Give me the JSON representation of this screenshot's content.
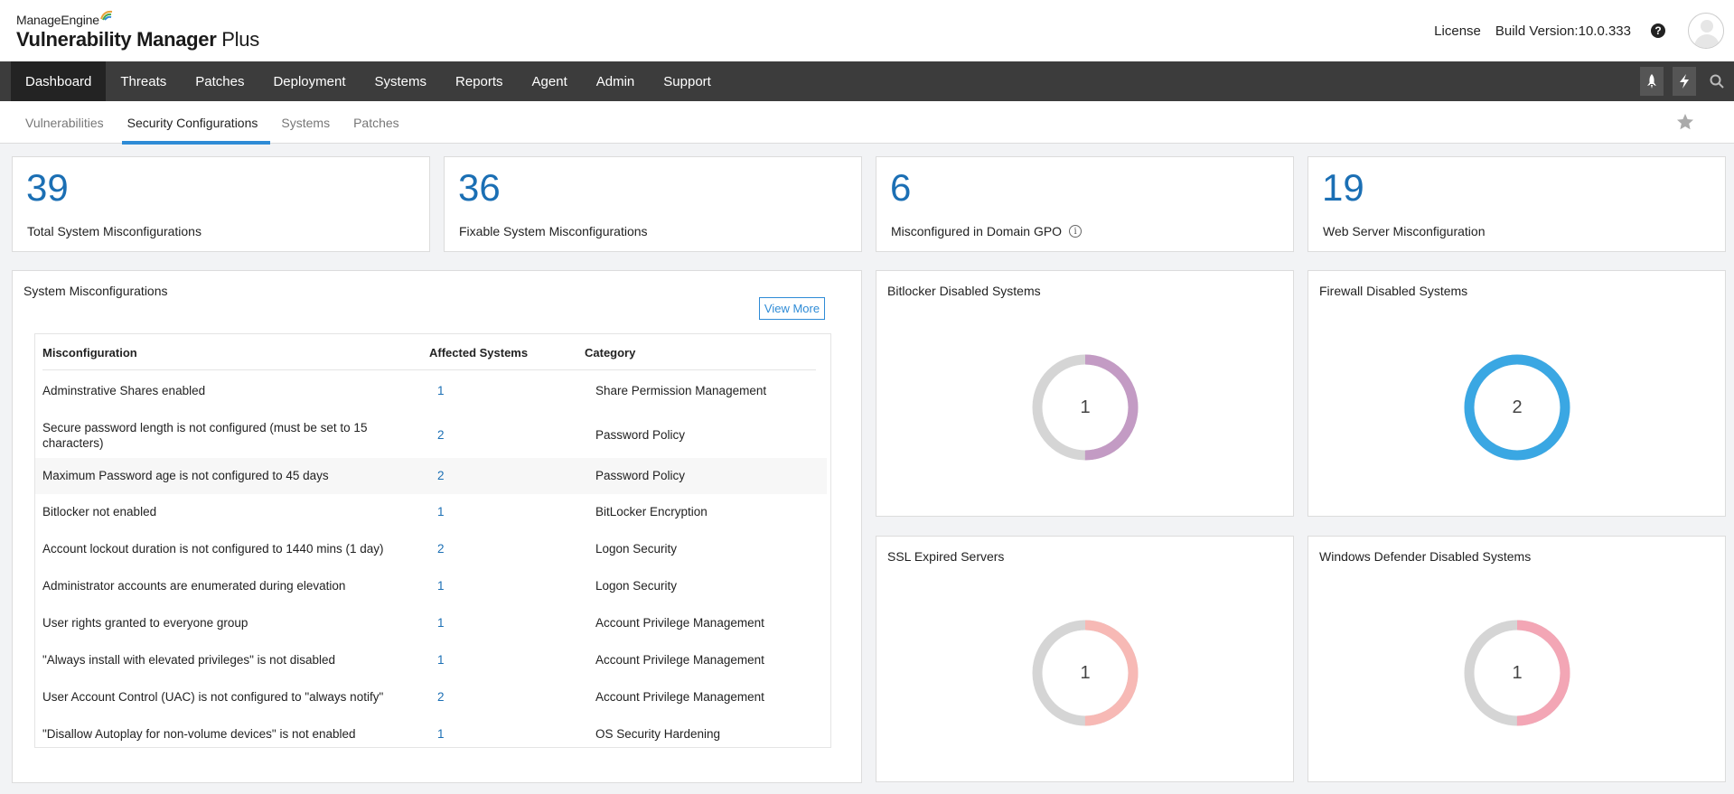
{
  "header": {
    "brand_company": "ManageEngine",
    "brand_product_bold": "Vulnerability Manager",
    "brand_product_plus": " Plus",
    "license_link": "License",
    "build_version": "Build Version:10.0.333",
    "help_icon": "?"
  },
  "main_nav": {
    "items": [
      {
        "label": "Dashboard",
        "active": true
      },
      {
        "label": "Threats"
      },
      {
        "label": "Patches"
      },
      {
        "label": "Deployment"
      },
      {
        "label": "Systems"
      },
      {
        "label": "Reports"
      },
      {
        "label": "Agent"
      },
      {
        "label": "Admin"
      },
      {
        "label": "Support"
      }
    ],
    "tools": [
      "rocket-icon",
      "lightning-icon",
      "search-icon"
    ]
  },
  "sub_nav": {
    "items": [
      {
        "label": "Vulnerabilities"
      },
      {
        "label": "Security Configurations",
        "active": true
      },
      {
        "label": "Systems"
      },
      {
        "label": "Patches"
      }
    ],
    "favorite_icon": "star-icon"
  },
  "stats": [
    {
      "value": "39",
      "label": "Total System Misconfigurations"
    },
    {
      "value": "36",
      "label": "Fixable System Misconfigurations"
    },
    {
      "value": "6",
      "label": "Misconfigured in Domain GPO",
      "info": "i"
    },
    {
      "value": "19",
      "label": "Web Server Misconfiguration"
    }
  ],
  "misconfig_panel": {
    "title": "System Misconfigurations",
    "view_more": "View More",
    "columns": [
      "Misconfiguration",
      "Affected Systems",
      "Category"
    ],
    "rows": [
      {
        "name": "Adminstrative Shares enabled",
        "count": "1",
        "category": "Share Permission Management"
      },
      {
        "name": "Secure password length is not configured (must be set to 15 characters)",
        "count": "2",
        "category": "Password Policy"
      },
      {
        "name": "Maximum Password age is not configured to 45 days",
        "count": "2",
        "category": "Password Policy"
      },
      {
        "name": "Bitlocker not enabled",
        "count": "1",
        "category": "BitLocker Encryption"
      },
      {
        "name": "Account lockout duration is not configured to 1440 mins (1 day)",
        "count": "2",
        "category": "Logon Security"
      },
      {
        "name": "Administrator accounts are enumerated during elevation",
        "count": "1",
        "category": "Logon Security"
      },
      {
        "name": "User rights granted to everyone group",
        "count": "1",
        "category": "Account Privilege Management"
      },
      {
        "name": "\"Always install with elevated privileges\" is not disabled",
        "count": "1",
        "category": "Account Privilege Management"
      },
      {
        "name": "User Account Control (UAC) is not configured to \"always notify\"",
        "count": "2",
        "category": "Account Privilege Management"
      },
      {
        "name": "\"Disallow Autoplay for non-volume devices\" is not enabled",
        "count": "1",
        "category": "OS Security Hardening"
      }
    ]
  },
  "donuts": [
    {
      "title": "Bitlocker Disabled Systems",
      "center": "1",
      "colored_fraction": 0.5,
      "color": "#c39bc4",
      "rest_color": "#d5d5d5"
    },
    {
      "title": "Firewall Disabled Systems",
      "center": "2",
      "colored_fraction": 1.0,
      "color": "#3aa7e3",
      "rest_color": "#d5d5d5"
    },
    {
      "title": "SSL Expired Servers",
      "center": "1",
      "colored_fraction": 0.5,
      "color": "#f7b9b5",
      "rest_color": "#d5d5d5"
    },
    {
      "title": "Windows Defender Disabled Systems",
      "center": "1",
      "colored_fraction": 0.5,
      "color": "#f3a6b5",
      "rest_color": "#d5d5d5"
    }
  ],
  "colors": {
    "accent": "#1b6fb4",
    "nav_bg": "#3c3c3c",
    "nav_active": "#232323",
    "tab_underline": "#2e8bd6"
  }
}
